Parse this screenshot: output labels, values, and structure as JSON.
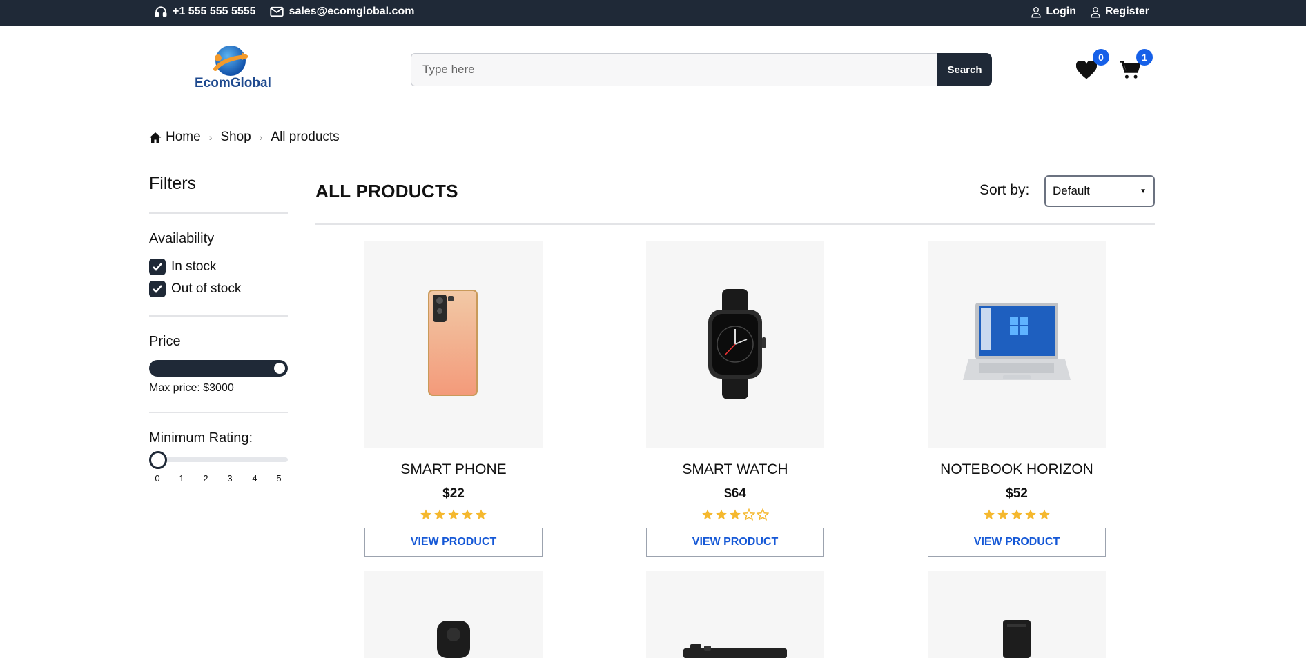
{
  "topbar": {
    "phone": "+1 555 555 5555",
    "email": "sales@ecomglobal.com",
    "login": "Login",
    "register": "Register",
    "background_color": "#1f2937"
  },
  "logo": {
    "text": "EcomGlobal"
  },
  "search": {
    "placeholder": "Type here",
    "button": "Search"
  },
  "wishlist": {
    "count": "0"
  },
  "cart": {
    "count": "1"
  },
  "breadcrumb": {
    "items": [
      "Home",
      "Shop",
      "All products"
    ]
  },
  "filters": {
    "title": "Filters",
    "availability": {
      "title": "Availability",
      "options": [
        {
          "label": "In stock",
          "checked": true
        },
        {
          "label": "Out of stock",
          "checked": true
        }
      ]
    },
    "price": {
      "title": "Price",
      "max_label": "Max price: $3000",
      "level": 1.0
    },
    "rating": {
      "title": "Minimum Rating:",
      "value": 0,
      "ticks": [
        "0",
        "1",
        "2",
        "3",
        "4",
        "5"
      ]
    }
  },
  "main": {
    "title": "ALL PRODUCTS",
    "sort": {
      "label": "Sort by:",
      "selected": "Default"
    }
  },
  "products": [
    {
      "name": "SMART PHONE",
      "price": "$22",
      "rating": 5,
      "button": "VIEW PRODUCT"
    },
    {
      "name": "SMART WATCH",
      "price": "$64",
      "rating": 3,
      "button": "VIEW PRODUCT"
    },
    {
      "name": "NOTEBOOK HORIZON",
      "price": "$52",
      "rating": 5,
      "button": "VIEW PRODUCT"
    }
  ],
  "colors": {
    "accent": "#1660e8",
    "dark": "#1f2937",
    "star": "#f5b82e",
    "link": "#1558d6"
  }
}
